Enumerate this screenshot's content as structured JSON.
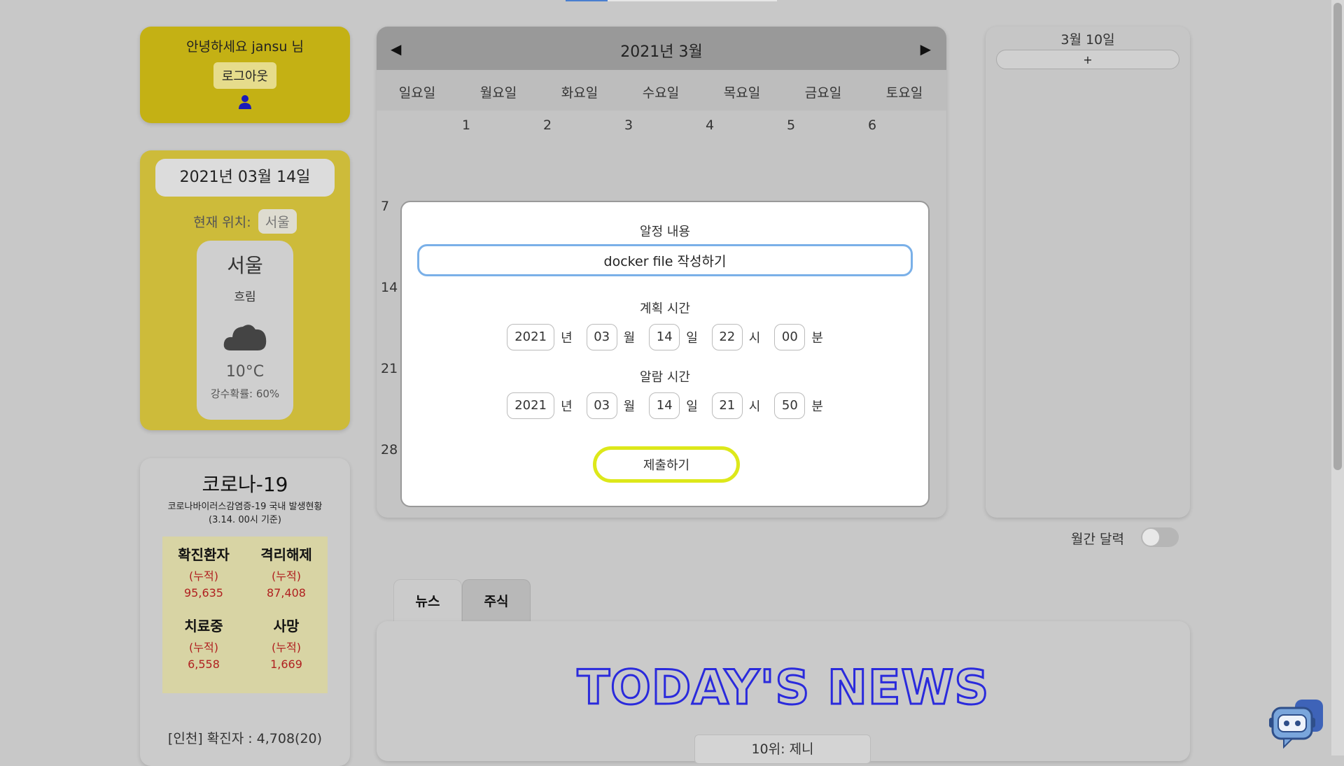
{
  "user": {
    "greeting": "안녕하세요 jansu 님",
    "logout_label": "로그아웃"
  },
  "weather": {
    "date": "2021년 03월 14일",
    "location_label": "현재 위치:",
    "location_value": "서울",
    "city": "서울",
    "description": "흐림",
    "icon": "cloud-icon",
    "temperature": "10°C",
    "rain_chance": "강수확률: 60%"
  },
  "covid": {
    "title": "코로나-19",
    "subtitle": "코로나바이러스감염증-19 국내 발생현황",
    "basis": "(3.14. 00시 기준)",
    "stats": [
      {
        "label": "확진환자",
        "cum": "(누적)",
        "value": "95,635"
      },
      {
        "label": "격리해제",
        "cum": "(누적)",
        "value": "87,408"
      },
      {
        "label": "치료중",
        "cum": "(누적)",
        "value": "6,558"
      },
      {
        "label": "사망",
        "cum": "(누적)",
        "value": "1,669"
      }
    ],
    "footer": "[인천] 확진자 : 4,708(20)"
  },
  "calendar": {
    "title": "2021년 3월",
    "prev": "◀",
    "next": "▶",
    "weekdays": [
      "일요일",
      "월요일",
      "화요일",
      "수요일",
      "목요일",
      "금요일",
      "토요일"
    ],
    "dates_row1": [
      "1",
      "2",
      "3",
      "4",
      "5",
      "6"
    ],
    "week_starts": [
      "7",
      "14",
      "21",
      "28"
    ]
  },
  "modal": {
    "content_label": "알정 내용",
    "content_value": "docker file 작성하기",
    "plan_label": "계획 시간",
    "plan": {
      "year": "2021",
      "month": "03",
      "day": "14",
      "hour": "22",
      "minute": "00"
    },
    "alarm_label": "알람 시간",
    "alarm": {
      "year": "2021",
      "month": "03",
      "day": "14",
      "hour": "21",
      "minute": "50"
    },
    "units": {
      "year": "년",
      "month": "월",
      "day": "일",
      "hour": "시",
      "minute": "분"
    },
    "submit_label": "제출하기"
  },
  "schedule": {
    "date": "3월 10일",
    "add_label": "+"
  },
  "monthly_toggle": {
    "label": "월간 달력",
    "on": false
  },
  "tabs": [
    {
      "label": "뉴스",
      "active": true
    },
    {
      "label": "주식",
      "active": false
    }
  ],
  "news": {
    "title": "TODAY'S NEWS",
    "rank_item": "10위: 제니"
  },
  "colors": {
    "user_card": "#c4b114",
    "weather_card": "#cdbb3a",
    "news_title": "#2a2adc",
    "submit_border": "#dde81a",
    "input_border": "#7ab0e8"
  }
}
